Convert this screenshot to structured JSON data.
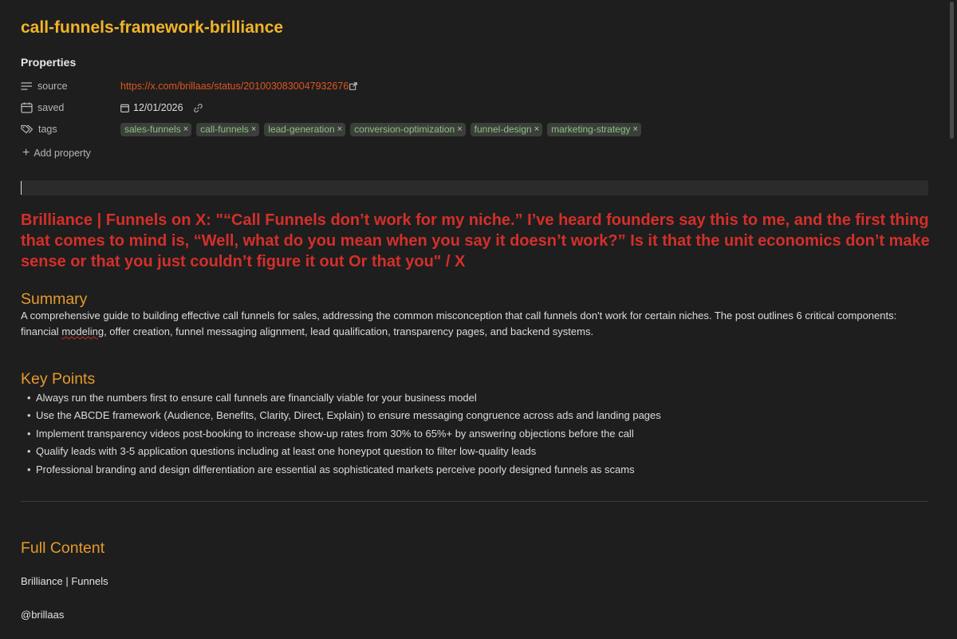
{
  "note": {
    "title": "call-funnels-framework-brilliance"
  },
  "properties": {
    "heading": "Properties",
    "source": {
      "key": "source",
      "icon": "text-lines-icon",
      "value": "https://x.com/brillaas/status/2010030830047932676"
    },
    "saved": {
      "key": "saved",
      "icon": "calendar-icon",
      "value": "12/01/2026"
    },
    "tags": {
      "key": "tags",
      "icon": "tags-icon",
      "items": [
        "sales-funnels",
        "call-funnels",
        "lead-generation",
        "conversion-optimization",
        "funnel-design",
        "marketing-strategy"
      ],
      "remove_glyph": "×"
    },
    "add_label": "Add property"
  },
  "heading_red": "Brilliance | Funnels on X: \"“Call Funnels don’t work for my niche.” I’ve heard founders say this to me, and the first thing that comes to mind is, “Well, what do you mean when you say it doesn’t work?” Is it that the unit economics don’t make sense or that you just couldn’t figure it out Or that you\" / X",
  "summary": {
    "heading": "Summary",
    "text_before": "A comprehensive guide to building effective call funnels for sales, addressing the common misconception that call funnels don't work for certain niches. The post outlines 6 critical components: financial ",
    "text_misspelled": "modeling",
    "text_after": ", offer creation, funnel messaging alignment, lead qualification, transparency pages, and backend systems."
  },
  "key_points": {
    "heading": "Key Points",
    "items": [
      "Always run the numbers first to ensure call funnels are financially viable for your business model",
      "Use the ABCDE framework (Audience, Benefits, Clarity, Direct, Explain) to ensure messaging congruence across ads and landing pages",
      "Implement transparency videos post-booking to increase show-up rates from 30% to 65%+ by answering objections before the call",
      "Qualify leads with 3-5 application questions including at least one honeypot question to filter low-quality leads",
      "Professional branding and design differentiation are essential as sophisticated markets perceive poorly designed funnels as scams"
    ]
  },
  "full_content": {
    "heading": "Full Content",
    "line1": "Brilliance | Funnels",
    "line2": "@brillaas"
  },
  "colors": {
    "background": "#1e1e1e",
    "title": "#f0b42a",
    "section_heading": "#e59a2c",
    "red_heading": "#d42f2a",
    "link": "#e0541f",
    "tag_bg": "#3b3f3a",
    "tag_text": "#8fbf85"
  }
}
